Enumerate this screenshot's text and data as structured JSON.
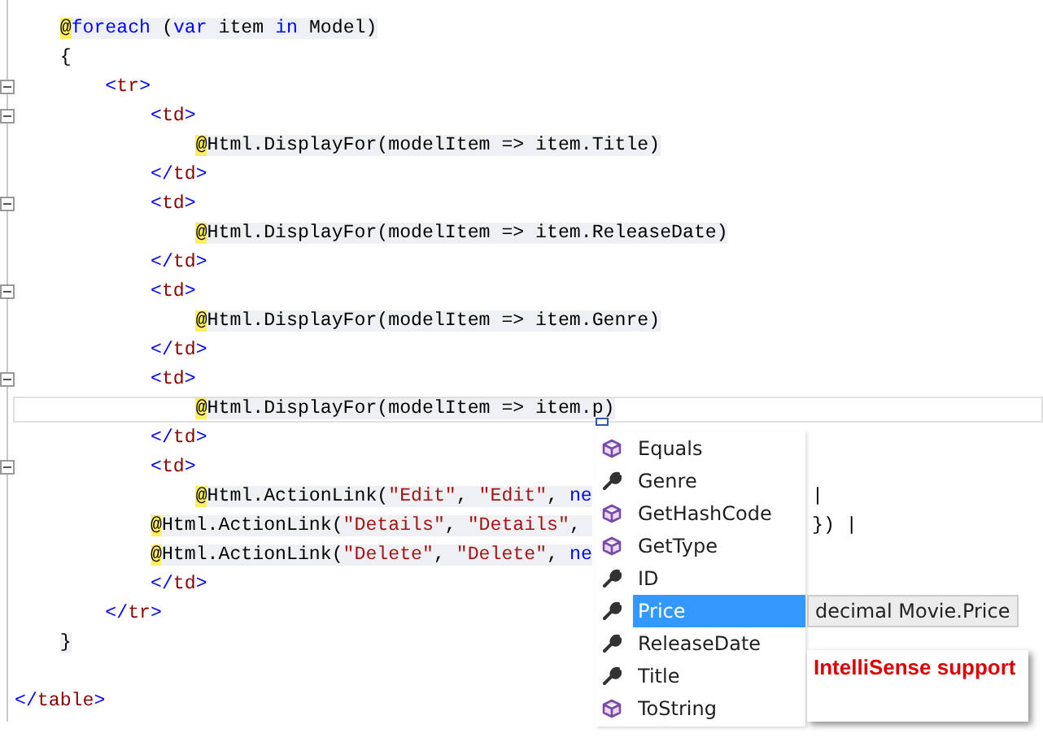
{
  "editor": {
    "lines": [
      {
        "kind": "code",
        "razor": true,
        "tokens": [
          {
            "kind": "at",
            "text": "    @"
          },
          {
            "kind": "kw",
            "text": "foreach"
          },
          {
            "kind": "plain",
            "text": " ("
          },
          {
            "kind": "kw",
            "text": "var"
          },
          {
            "kind": "plain",
            "text": " item "
          },
          {
            "kind": "kw",
            "text": "in"
          },
          {
            "kind": "plain",
            "text": " Model)"
          }
        ]
      },
      {
        "kind": "code",
        "tokens": [
          {
            "kind": "plain",
            "text": "    {"
          }
        ]
      },
      {
        "kind": "code",
        "collapsible": true,
        "tokens": [
          {
            "kind": "tag",
            "text": "        <"
          },
          {
            "kind": "tn",
            "text": "tr"
          },
          {
            "kind": "tag",
            "text": ">"
          }
        ]
      },
      {
        "kind": "code",
        "collapsible": true,
        "tokens": [
          {
            "kind": "tag",
            "text": "            <"
          },
          {
            "kind": "tn",
            "text": "td"
          },
          {
            "kind": "tag",
            "text": ">"
          }
        ]
      },
      {
        "kind": "code",
        "razor": true,
        "tokens": [
          {
            "kind": "at",
            "text": "                @"
          },
          {
            "kind": "plain",
            "text": "Html.DisplayFor(modelItem => item.Title)"
          }
        ]
      },
      {
        "kind": "code",
        "tokens": [
          {
            "kind": "tag",
            "text": "            </"
          },
          {
            "kind": "tn",
            "text": "td"
          },
          {
            "kind": "tag",
            "text": ">"
          }
        ]
      },
      {
        "kind": "code",
        "collapsible": true,
        "tokens": [
          {
            "kind": "tag",
            "text": "            <"
          },
          {
            "kind": "tn",
            "text": "td"
          },
          {
            "kind": "tag",
            "text": ">"
          }
        ]
      },
      {
        "kind": "code",
        "razor": true,
        "tokens": [
          {
            "kind": "at",
            "text": "                @"
          },
          {
            "kind": "plain",
            "text": "Html.DisplayFor(modelItem => item.ReleaseDate)"
          }
        ]
      },
      {
        "kind": "code",
        "tokens": [
          {
            "kind": "tag",
            "text": "            </"
          },
          {
            "kind": "tn",
            "text": "td"
          },
          {
            "kind": "tag",
            "text": ">"
          }
        ]
      },
      {
        "kind": "code",
        "collapsible": true,
        "tokens": [
          {
            "kind": "tag",
            "text": "            <"
          },
          {
            "kind": "tn",
            "text": "td"
          },
          {
            "kind": "tag",
            "text": ">"
          }
        ]
      },
      {
        "kind": "code",
        "razor": true,
        "tokens": [
          {
            "kind": "at",
            "text": "                @"
          },
          {
            "kind": "plain",
            "text": "Html.DisplayFor(modelItem => item.Genre)"
          }
        ]
      },
      {
        "kind": "code",
        "tokens": [
          {
            "kind": "tag",
            "text": "            </"
          },
          {
            "kind": "tn",
            "text": "td"
          },
          {
            "kind": "tag",
            "text": ">"
          }
        ]
      },
      {
        "kind": "code",
        "collapsible": true,
        "tokens": [
          {
            "kind": "tag",
            "text": "            <"
          },
          {
            "kind": "tn",
            "text": "td"
          },
          {
            "kind": "tag",
            "text": ">"
          }
        ]
      },
      {
        "kind": "code",
        "razor": true,
        "current": true,
        "tokens": [
          {
            "kind": "at",
            "text": "                @"
          },
          {
            "kind": "plain",
            "text": "Html.DisplayFor(modelItem => item.p)"
          }
        ]
      },
      {
        "kind": "code",
        "tokens": [
          {
            "kind": "tag",
            "text": "            </"
          },
          {
            "kind": "tn",
            "text": "td"
          },
          {
            "kind": "tag",
            "text": ">"
          }
        ]
      },
      {
        "kind": "code",
        "collapsible": true,
        "tokens": [
          {
            "kind": "tag",
            "text": "            <"
          },
          {
            "kind": "tn",
            "text": "td"
          },
          {
            "kind": "tag",
            "text": ">"
          }
        ]
      },
      {
        "kind": "code",
        "razor": true,
        "tail": "|",
        "tokens": [
          {
            "kind": "at",
            "text": "                @"
          },
          {
            "kind": "plain",
            "text": "Html.ActionLink("
          },
          {
            "kind": "str",
            "text": "\"Edit\""
          },
          {
            "kind": "plain",
            "text": ", "
          },
          {
            "kind": "str",
            "text": "\"Edit\""
          },
          {
            "kind": "plain",
            "text": ", "
          },
          {
            "kind": "kw",
            "text": "ne"
          }
        ]
      },
      {
        "kind": "code",
        "razor": true,
        "tail": "}) |",
        "tokens": [
          {
            "kind": "at",
            "text": "            @"
          },
          {
            "kind": "plain",
            "text": "Html.ActionLink("
          },
          {
            "kind": "str",
            "text": "\"Details\""
          },
          {
            "kind": "plain",
            "text": ", "
          },
          {
            "kind": "str",
            "text": "\"Details\""
          },
          {
            "kind": "plain",
            "text": ", "
          }
        ]
      },
      {
        "kind": "code",
        "razor": true,
        "tokens": [
          {
            "kind": "at",
            "text": "            @"
          },
          {
            "kind": "plain",
            "text": "Html.ActionLink("
          },
          {
            "kind": "str",
            "text": "\"Delete\""
          },
          {
            "kind": "plain",
            "text": ", "
          },
          {
            "kind": "str",
            "text": "\"Delete\""
          },
          {
            "kind": "plain",
            "text": ", "
          },
          {
            "kind": "kw",
            "text": "ne"
          }
        ]
      },
      {
        "kind": "code",
        "tokens": [
          {
            "kind": "tag",
            "text": "            </"
          },
          {
            "kind": "tn",
            "text": "td"
          },
          {
            "kind": "tag",
            "text": ">"
          }
        ]
      },
      {
        "kind": "code",
        "tokens": [
          {
            "kind": "tag",
            "text": "        </"
          },
          {
            "kind": "tn",
            "text": "tr"
          },
          {
            "kind": "tag",
            "text": ">"
          }
        ]
      },
      {
        "kind": "code",
        "razor": true,
        "tokens": [
          {
            "kind": "plain",
            "text": "    }"
          }
        ]
      },
      {
        "kind": "blank"
      },
      {
        "kind": "code",
        "tokens": [
          {
            "kind": "tag",
            "text": "</"
          },
          {
            "kind": "tn",
            "text": "table"
          },
          {
            "kind": "tag",
            "text": ">"
          }
        ]
      }
    ]
  },
  "completion": {
    "items": [
      {
        "label": "Equals",
        "kind": "method",
        "selected": false
      },
      {
        "label": "Genre",
        "kind": "property",
        "selected": false
      },
      {
        "label": "GetHashCode",
        "kind": "method",
        "selected": false
      },
      {
        "label": "GetType",
        "kind": "method",
        "selected": false
      },
      {
        "label": "ID",
        "kind": "property",
        "selected": false
      },
      {
        "label": "Price",
        "kind": "property",
        "selected": true
      },
      {
        "label": "ReleaseDate",
        "kind": "property",
        "selected": false
      },
      {
        "label": "Title",
        "kind": "property",
        "selected": false
      },
      {
        "label": "ToString",
        "kind": "method",
        "selected": false
      }
    ],
    "tooltip": "decimal Movie.Price"
  },
  "callout": {
    "text": "IntelliSense support"
  }
}
